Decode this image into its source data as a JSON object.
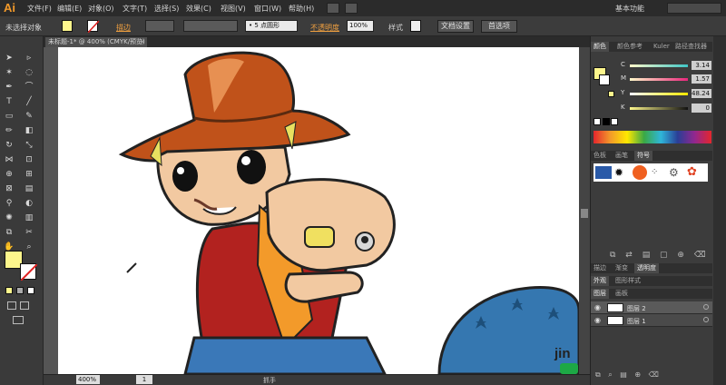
{
  "app": {
    "logo_text": "Ai"
  },
  "menu": [
    {
      "label": "文件(F)"
    },
    {
      "label": "编辑(E)"
    },
    {
      "label": "对象(O)"
    },
    {
      "label": "文字(T)"
    },
    {
      "label": "选择(S)"
    },
    {
      "label": "效果(C)"
    },
    {
      "label": "视图(V)"
    },
    {
      "label": "窗口(W)"
    },
    {
      "label": "帮助(H)"
    }
  ],
  "workspace": {
    "label": "基本功能"
  },
  "control": {
    "selection_label": "未选择对象",
    "stroke_label": "描边",
    "brush_label": "5 点圆形",
    "opacity_label": "不透明度",
    "opacity_value": "100%",
    "style_label": "样式",
    "doc_setup_button": "文档设置",
    "preferences_button": "首选项"
  },
  "document": {
    "tab_title": "未标题-1* @ 400% (CMYK/预览)"
  },
  "status": {
    "zoom": "400%",
    "page": "1",
    "tool_name": "抓手"
  },
  "color_panel": {
    "tabs": [
      "颜色",
      "颜色参考",
      "Kuler",
      "路径查找器"
    ],
    "channels": [
      {
        "name": "C",
        "value": "3.14"
      },
      {
        "name": "M",
        "value": "1.57"
      },
      {
        "name": "Y",
        "value": "48.24"
      },
      {
        "name": "K",
        "value": "0"
      }
    ],
    "colors": {
      "fill": "#fdf68c",
      "accent": "#f39a2a"
    }
  },
  "symbol_panel": {
    "tabs": [
      "色板",
      "画笔",
      "符号"
    ]
  },
  "stroke_panel": {
    "tabs": [
      "描边",
      "渐变",
      "透明度"
    ]
  },
  "appearance_panel": {
    "tabs": [
      "外观",
      "图形样式"
    ]
  },
  "layers_panel": {
    "tabs": [
      "图层",
      "画板"
    ],
    "layers": [
      {
        "name": "图层 2"
      },
      {
        "name": "图层 1"
      }
    ]
  },
  "watermark": {
    "text": "jin"
  }
}
